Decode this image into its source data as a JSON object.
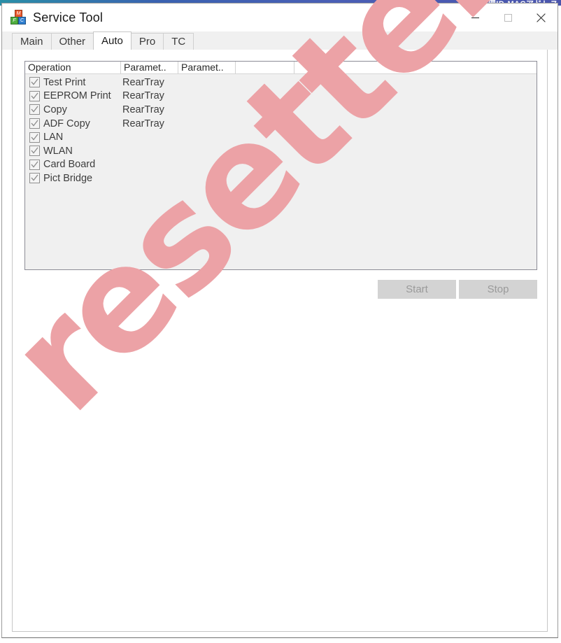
{
  "background_window": {
    "title_fragment": "MAC 管理ID-MACアドレス"
  },
  "window": {
    "title": "Service Tool",
    "icon": "app-blocks-icon",
    "icon_letters": [
      "M",
      "F",
      "C"
    ],
    "controls": {
      "minimize": "minimize-icon",
      "maximize": "maximize-icon",
      "close": "close-icon"
    }
  },
  "tabs": [
    {
      "label": "Main",
      "selected": false
    },
    {
      "label": "Other",
      "selected": false
    },
    {
      "label": "Auto",
      "selected": true
    },
    {
      "label": "Pro",
      "selected": false
    },
    {
      "label": "TC",
      "selected": false
    }
  ],
  "operation_list": {
    "columns": [
      "Operation",
      "Paramet..",
      "Paramet..",
      "",
      ""
    ],
    "rows": [
      {
        "checked": true,
        "operation": "Test Print",
        "param1": "RearTray",
        "param2": ""
      },
      {
        "checked": true,
        "operation": "EEPROM Print",
        "param1": "RearTray",
        "param2": ""
      },
      {
        "checked": true,
        "operation": "Copy",
        "param1": "RearTray",
        "param2": ""
      },
      {
        "checked": true,
        "operation": "ADF Copy",
        "param1": "RearTray",
        "param2": ""
      },
      {
        "checked": true,
        "operation": "LAN",
        "param1": "",
        "param2": ""
      },
      {
        "checked": true,
        "operation": "WLAN",
        "param1": "",
        "param2": ""
      },
      {
        "checked": true,
        "operation": "Card Board",
        "param1": "",
        "param2": ""
      },
      {
        "checked": true,
        "operation": "Pict Bridge",
        "param1": "",
        "param2": ""
      }
    ]
  },
  "actions": {
    "start_label": "Start",
    "stop_label": "Stop",
    "start_enabled": false,
    "stop_enabled": false
  },
  "watermark": {
    "text": "resetter.net",
    "color": "#eca2a6"
  }
}
